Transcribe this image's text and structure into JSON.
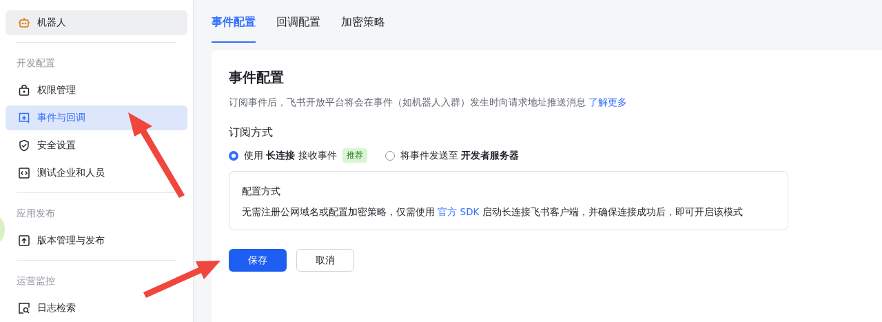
{
  "sidebar": {
    "groups": [
      {
        "items": [
          {
            "label": "机器人",
            "kind": "robot",
            "selected": false,
            "hovered": true
          }
        ]
      },
      {
        "title": "开发配置",
        "items": [
          {
            "label": "权限管理",
            "kind": "lock",
            "selected": false,
            "hovered": false
          },
          {
            "label": "事件与回调",
            "kind": "event",
            "selected": true,
            "hovered": false
          },
          {
            "label": "安全设置",
            "kind": "shield",
            "selected": false,
            "hovered": false
          },
          {
            "label": "测试企业和人员",
            "kind": "code",
            "selected": false,
            "hovered": false
          }
        ]
      },
      {
        "title": "应用发布",
        "items": [
          {
            "label": "版本管理与发布",
            "kind": "upload",
            "selected": false,
            "hovered": false
          }
        ]
      },
      {
        "title": "运营监控",
        "items": [
          {
            "label": "日志检索",
            "kind": "log",
            "selected": false,
            "hovered": false
          }
        ]
      }
    ]
  },
  "tabs": [
    {
      "label": "事件配置",
      "selected": true
    },
    {
      "label": "回调配置",
      "selected": false
    },
    {
      "label": "加密策略",
      "selected": false
    }
  ],
  "card": {
    "title": "事件配置",
    "description": {
      "text": "订阅事件后，飞书开放平台将会在事件（如机器人入群）发生时向请求地址推送消息",
      "link": "了解更多"
    },
    "subscription": {
      "title": "订阅方式",
      "options": [
        {
          "label": "使用 **长连接** 接收事件",
          "badge": "推荐",
          "selected": true
        },
        {
          "label": "将事件发送至 **开发者服务器**",
          "selected": false
        }
      ]
    },
    "mode_box": {
      "title": "配置方式",
      "before": "无需注册公网域名或配置加密策略，仅需使用",
      "link": "官方 SDK",
      "after": "启动长连接飞书客户端，并确保连接成功后，即可开启该模式"
    },
    "buttons": [
      {
        "label": "保存",
        "kind": "primary"
      },
      {
        "label": "取消",
        "kind": "secondary"
      }
    ]
  }
}
